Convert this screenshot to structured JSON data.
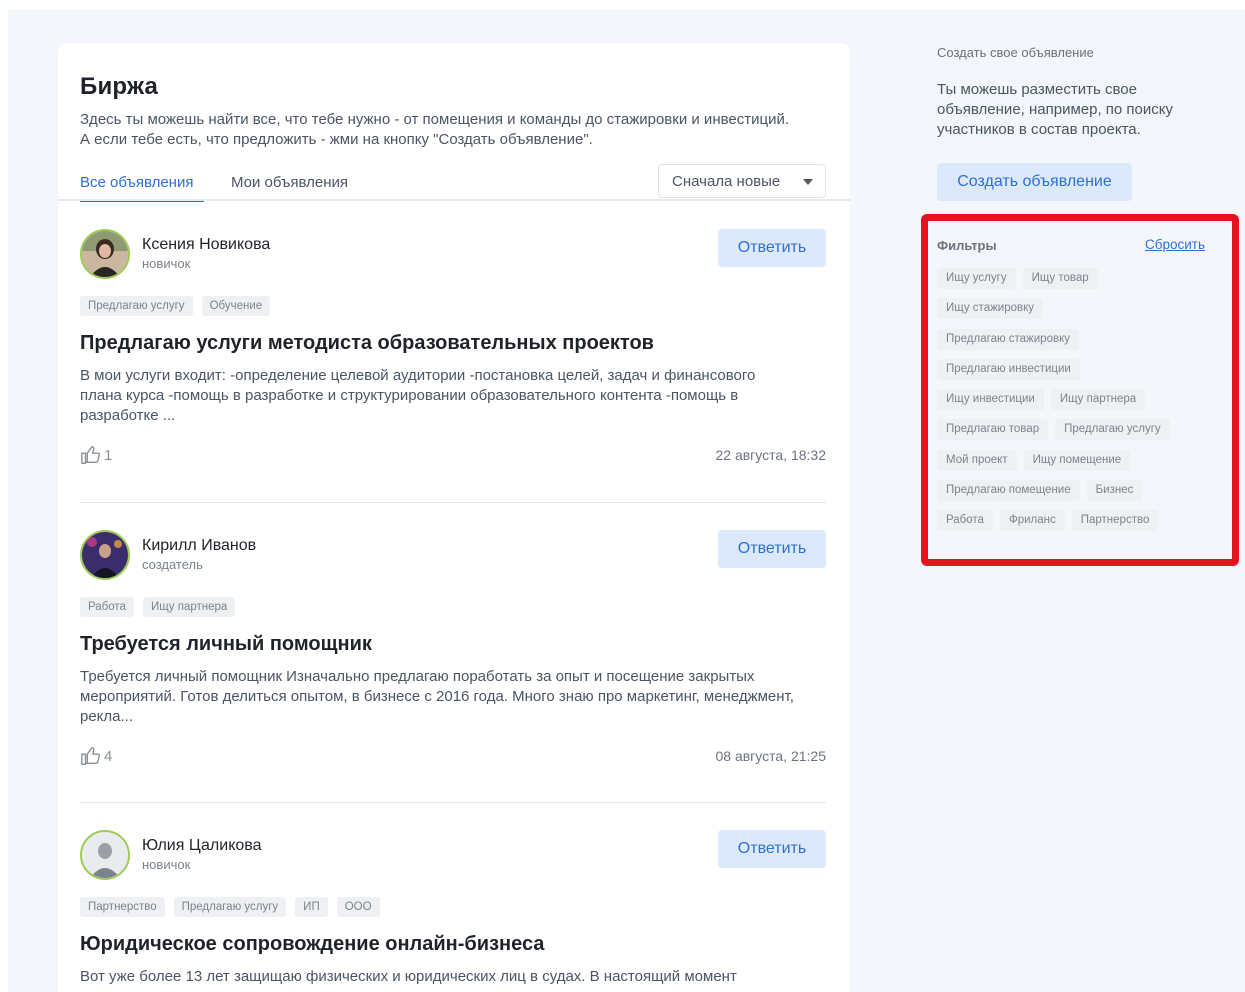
{
  "page": {
    "title": "Биржа",
    "description": "Здесь ты можешь найти все, что тебе нужно - от помещения и команды до стажировки и инвестиций. А если тебе есть, что предложить - жми на кнопку \"Создать объявление\"."
  },
  "tabs": [
    {
      "label": "Все объявления",
      "active": true
    },
    {
      "label": "Мои объявления",
      "active": false
    }
  ],
  "sort": {
    "selected": "Сначала новые"
  },
  "reply_label": "Ответить",
  "posts": [
    {
      "author": "Ксения Новикова",
      "role": "новичок",
      "tags": [
        "Предлагаю услугу",
        "Обучение"
      ],
      "title": "Предлагаю услуги методиста образовательных проектов",
      "text": "В мои услуги входит: -определение целевой аудитории -постановка целей, задач и финансового плана курса -помощь в разработке и структурировании образовательного контента -помощь в разработке ...",
      "likes": "1",
      "date": "22 августа, 18:32"
    },
    {
      "author": "Кирилл Иванов",
      "role": "создатель",
      "tags": [
        "Работа",
        "Ищу партнера"
      ],
      "title": "Требуется личный помощник",
      "text": "Требуется личный помощник Изначально предлагаю поработать за опыт и посещение закрытых мероприятий. Готов делиться опытом, в бизнесе с 2016 года. Много знаю про маркетинг, менеджмент, рекла...",
      "likes": "4",
      "date": "08 августа, 21:25"
    },
    {
      "author": "Юлия Цаликова",
      "role": "новичок",
      "tags": [
        "Партнерство",
        "Предлагаю услугу",
        "ИП",
        "ООО"
      ],
      "title": "Юридическое сопровождение онлайн-бизнеса",
      "text": "Вот уже более 13 лет защищаю физических и юридических лиц в судах. В настоящий момент",
      "likes": "",
      "date": ""
    }
  ],
  "sidebar": {
    "heading": "Создать свое объявление",
    "text": "Ты можешь разместить свое объявление, например, по поиску участников в состав проекта.",
    "create_button": "Создать объявление",
    "filters": {
      "title": "Фильтры",
      "reset": "Сбросить",
      "rows": [
        [
          "Ищу услугу",
          "Ищу товар"
        ],
        [
          "Ищу стажировку"
        ],
        [
          "Предлагаю стажировку"
        ],
        [
          "Предлагаю инвестиции"
        ],
        [
          "Ищу инвестиции",
          "Ищу партнера"
        ],
        [
          "Предлагаю товар",
          "Предлагаю услугу"
        ],
        [
          "Мой проект",
          "Ищу помещение"
        ],
        [
          "Предлагаю помещение",
          "Бизнес"
        ],
        [
          "Работа",
          "Фриланс",
          "Партнерство"
        ]
      ]
    }
  },
  "colors": {
    "accent": "#2f6fd6",
    "button_bg": "#dce9fb",
    "highlight_border": "#e3141d",
    "avatar_ring": "#9ecb53"
  }
}
